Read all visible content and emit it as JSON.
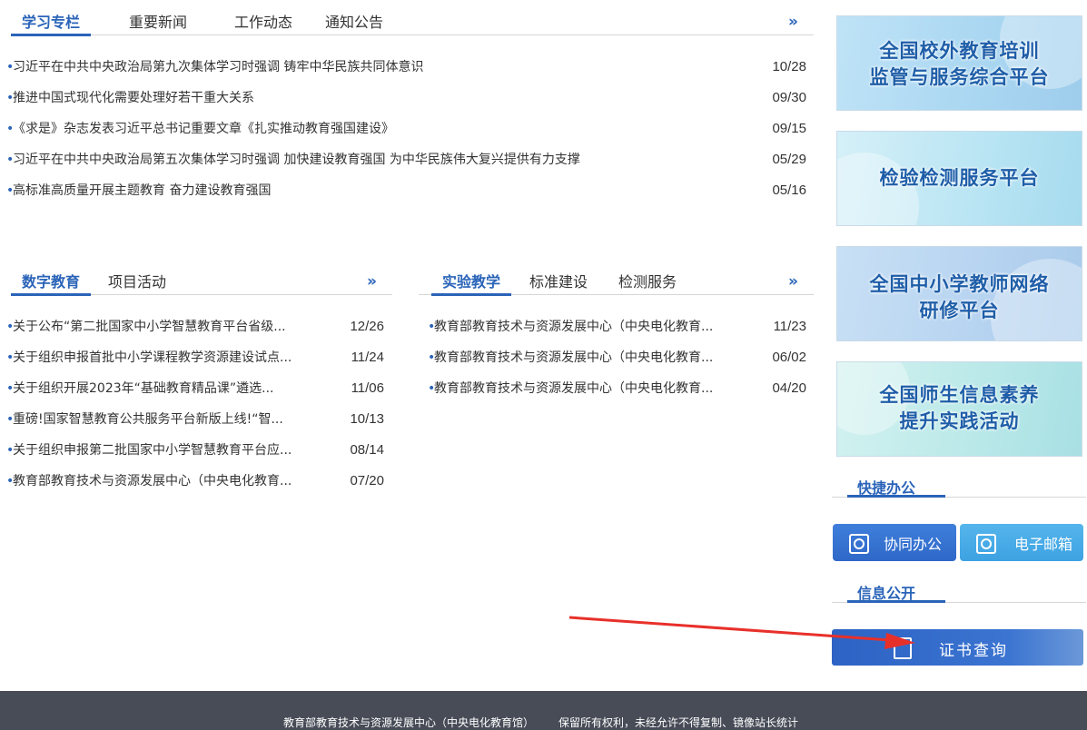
{
  "top_tabs": {
    "tabs": [
      "学习专栏",
      "重要新闻",
      "工作动态",
      "通知公告"
    ],
    "more": "»"
  },
  "top_news": [
    {
      "title": "习近平在中共中央政治局第九次集体学习时强调 铸牢中华民族共同体意识",
      "date": "10/28"
    },
    {
      "title": "推进中国式现代化需要处理好若干重大关系",
      "date": "09/30"
    },
    {
      "title": "《求是》杂志发表习近平总书记重要文章《扎实推动教育强国建设》",
      "date": "09/15"
    },
    {
      "title": "习近平在中共中央政治局第五次集体学习时强调 加快建设教育强国 为中华民族伟大复兴提供有力支撑",
      "date": "05/29"
    },
    {
      "title": "高标准高质量开展主题教育 奋力建设教育强国",
      "date": "05/16"
    }
  ],
  "left_tabs": {
    "tabs": [
      "数字教育",
      "项目活动"
    ],
    "more": "»"
  },
  "left_news": [
    {
      "title": "关于公布“第二批国家中小学智慧教育平台省级...",
      "date": "12/26"
    },
    {
      "title": "关于组织申报首批中小学课程教学资源建设试点...",
      "date": "11/24"
    },
    {
      "title": "关于组织开展2023年“基础教育精品课”遴选...",
      "date": "11/06"
    },
    {
      "title": "重磅!国家智慧教育公共服务平台新版上线!“智...",
      "date": "10/13"
    },
    {
      "title": "关于组织申报第二批国家中小学智慧教育平台应...",
      "date": "08/14"
    },
    {
      "title": "教育部教育技术与资源发展中心（中央电化教育...",
      "date": "07/20"
    }
  ],
  "right_tabs": {
    "tabs": [
      "实验教学",
      "标准建设",
      "检测服务"
    ],
    "more": "»"
  },
  "right_news": [
    {
      "title": "教育部教育技术与资源发展中心（中央电化教育...",
      "date": "11/23"
    },
    {
      "title": "教育部教育技术与资源发展中心（中央电化教育...",
      "date": "06/02"
    },
    {
      "title": "教育部教育技术与资源发展中心（中央电化教育...",
      "date": "04/20"
    }
  ],
  "banners": [
    {
      "line1": "全国校外教育培训",
      "line2": "监管与服务综合平台"
    },
    {
      "line1": "检验检测服务平台",
      "line2": ""
    },
    {
      "line1": "全国中小学教师网络",
      "line2": "研修平台"
    },
    {
      "line1": "全国师生信息素养",
      "line2": "提升实践活动"
    }
  ],
  "quick_office": {
    "title": "快捷办公",
    "buttons": [
      {
        "label": "协同办公",
        "icon": "collaboration-icon"
      },
      {
        "label": "电子邮箱",
        "icon": "mail-icon"
      }
    ]
  },
  "info_public": {
    "title": "信息公开",
    "button": {
      "label": "证书查询",
      "icon": "certificate-icon"
    }
  },
  "footer": {
    "org": "教育部教育技术与资源发展中心（中央电化教育馆）",
    "rights": "保留所有权利，未经允许不得复制、镜像站长统计"
  },
  "colors": {
    "accent": "#2a64b8",
    "footer_bg": "#474c57",
    "annotation_arrow": "#e8302a"
  }
}
